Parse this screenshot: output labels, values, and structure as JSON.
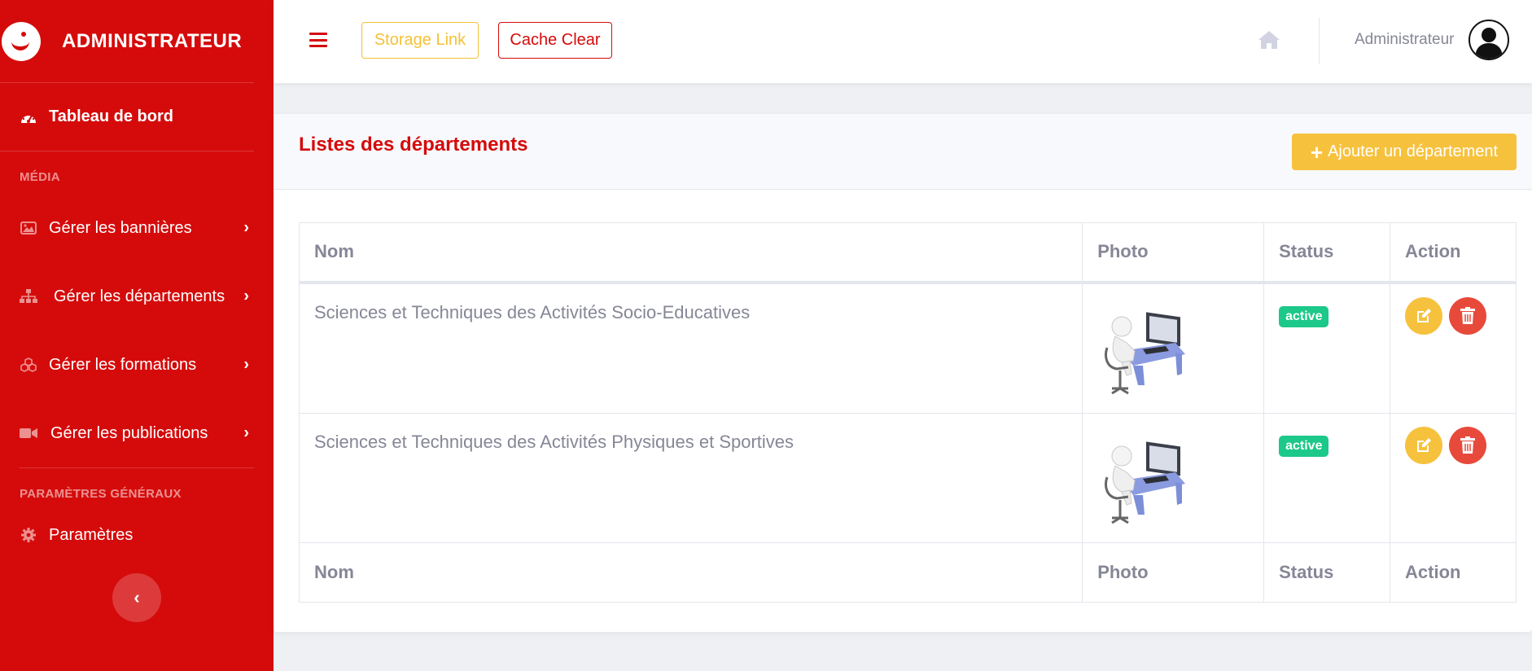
{
  "brand": {
    "title": "ADMINISTRATEUR"
  },
  "sidebar": {
    "dashboard": {
      "label": "Tableau de bord",
      "icon": "tachometer-icon"
    },
    "sections": [
      {
        "heading": "MÉDIA"
      },
      {
        "heading": "PARAMÈTRES GÉNÉRAUX"
      }
    ],
    "items": [
      {
        "label": "Gérer les bannières",
        "icon": "image-icon"
      },
      {
        "label": "Gérer les départements",
        "icon": "sitemap-icon"
      },
      {
        "label": "Gérer les formations",
        "icon": "cubes-icon"
      },
      {
        "label": "Gérer les publications",
        "icon": "video-icon"
      },
      {
        "label": "Paramètres",
        "icon": "gear-icon"
      }
    ],
    "collapse_glyph": "‹"
  },
  "topbar": {
    "storage_link": "Storage Link",
    "cache_clear": "Cache Clear",
    "user_name": "Administrateur"
  },
  "card": {
    "title": "Listes des départements",
    "add_button": "Ajouter un département"
  },
  "table": {
    "columns": [
      "Nom",
      "Photo",
      "Status",
      "Action"
    ],
    "rows": [
      {
        "nom": "Sciences et Techniques des Activités Socio-Educatives",
        "status": "active"
      },
      {
        "nom": "Sciences et Techniques des Activités Physiques et Sportives",
        "status": "active"
      }
    ]
  },
  "colors": {
    "primary_red": "#d50b0b",
    "warning": "#f6c23e",
    "danger": "#e74a3b",
    "success": "#1cc88a",
    "muted_text": "#858796"
  }
}
